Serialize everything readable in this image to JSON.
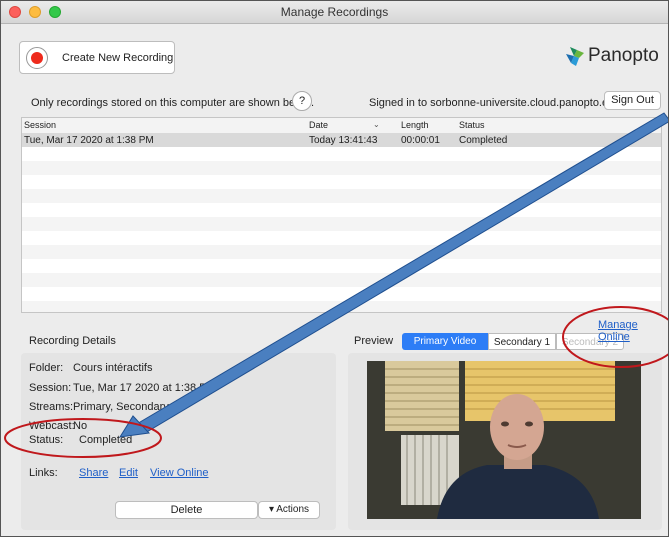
{
  "window": {
    "title": "Manage Recordings"
  },
  "toolbar": {
    "create_label": "Create New Recording",
    "brand": "Panopto"
  },
  "info": {
    "note": "Only recordings stored on this computer are shown below.",
    "help": "?",
    "signed_in": "Signed in to sorbonne-universite.cloud.panopto.eu",
    "signout": "Sign Out"
  },
  "table": {
    "headers": [
      "Session",
      "Date",
      "Length",
      "Status"
    ],
    "rows": [
      {
        "session": "Tue, Mar 17 2020 at 1:38 PM",
        "date": "Today 13:41:43",
        "length": "00:00:01",
        "status": "Completed"
      }
    ]
  },
  "manage_online": "Manage Online",
  "details": {
    "heading": "Recording Details",
    "fields": [
      {
        "k": "Folder:",
        "v": "Cours intéractifs"
      },
      {
        "k": "Session:",
        "v": "Tue, Mar 17 2020 at 1:38 PM"
      },
      {
        "k": "Streams:",
        "v": "Primary, Secondary"
      },
      {
        "k": "Webcast:",
        "v": "No"
      },
      {
        "k": "Status:",
        "v": "Completed"
      }
    ],
    "links_label": "Links:",
    "links": [
      "Share",
      "Edit",
      "View Online"
    ],
    "delete": "Delete",
    "actions": "Actions"
  },
  "preview": {
    "heading": "Preview",
    "tabs": [
      "Primary Video",
      "Secondary 1",
      "Secondary 2"
    ]
  },
  "colors": {
    "accent": "#2d7df6",
    "link": "#1f5fc8",
    "record": "#ee2a1c",
    "annotation_red": "#c0181c",
    "arrow_blue": "#4a7fc0"
  }
}
